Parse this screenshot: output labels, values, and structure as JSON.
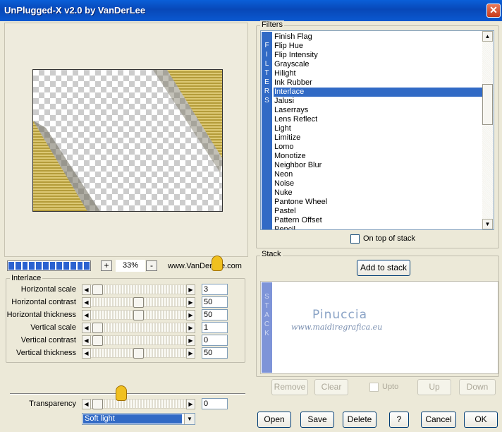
{
  "window": {
    "title": "UnPlugged-X v2.0 by VanDerLee",
    "close_glyph": "✕"
  },
  "zoom": {
    "minus": "-",
    "plus": "+",
    "value": "33%",
    "website": "www.VanDerLee.com",
    "progress_segments": 12
  },
  "interlace": {
    "group_title": "Interlace",
    "rows": [
      {
        "label": "Horizontal scale",
        "value": "3"
      },
      {
        "label": "Horizontal contrast",
        "value": "50"
      },
      {
        "label": "Horizontal thickness",
        "value": "50"
      },
      {
        "label": "Vertical scale",
        "value": "1"
      },
      {
        "label": "Vertical contrast",
        "value": "0"
      },
      {
        "label": "Vertical thickness",
        "value": "50"
      }
    ],
    "transparency_label": "Transparency",
    "transparency_value": "0",
    "blend_mode": "Soft light"
  },
  "filters": {
    "group_title": "Filters",
    "strip_text": [
      "F",
      "I",
      "L",
      "T",
      "E",
      "R",
      "S"
    ],
    "items": [
      "Finish Flag",
      "Flip Hue",
      "Flip Intensity",
      "Grayscale",
      "Hilight",
      "Ink Rubber",
      "Interlace",
      "Jalusi",
      "Laserrays",
      "Lens Reflect",
      "Light",
      "Limitize",
      "Lomo",
      "Monotize",
      "Neighbor Blur",
      "Neon",
      "Noise",
      "Nuke",
      "Pantone Wheel",
      "Pastel",
      "Pattern Offset",
      "Pencil"
    ],
    "selected": "Interlace",
    "on_top_label": "On top of stack"
  },
  "stack": {
    "group_title": "Stack",
    "add_button": "Add to stack",
    "strip_text": [
      "S",
      "T",
      "A",
      "C",
      "K"
    ],
    "watermark_title": "Pinuccia",
    "watermark_url": "www.maidiregrafica.eu",
    "remove": "Remove",
    "clear": "Clear",
    "upto": "Upto",
    "up": "Up",
    "down": "Down"
  },
  "footer": {
    "open": "Open",
    "save": "Save",
    "delete": "Delete",
    "help": "?",
    "cancel": "Cancel",
    "ok": "OK"
  },
  "colors": {
    "title_bar": "#0a5fd8",
    "selection": "#316ac5",
    "stripe_gold": "#d7c36a"
  }
}
